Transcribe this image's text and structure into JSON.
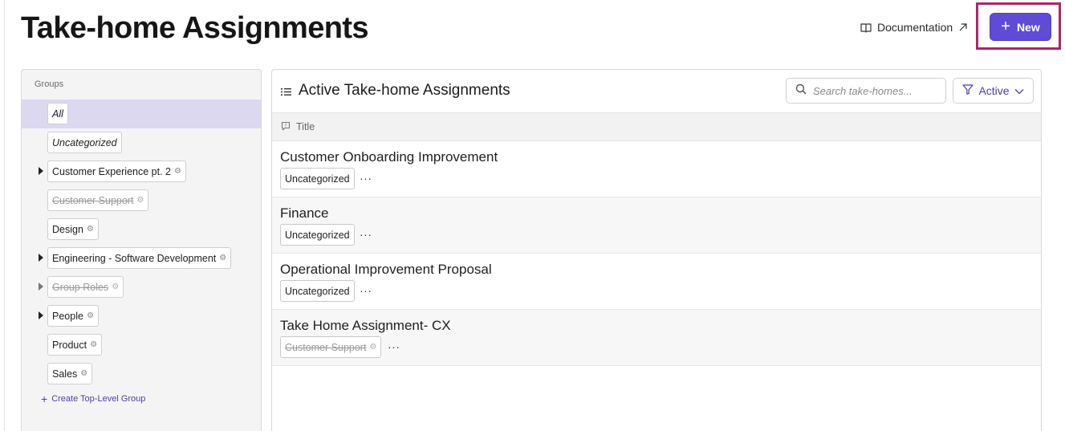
{
  "page": {
    "title": "Take-home Assignments"
  },
  "header": {
    "documentation_label": "Documentation",
    "new_button_label": "New"
  },
  "sidebar": {
    "heading": "Groups",
    "groups": [
      {
        "label": "All",
        "selected": true,
        "italic": true,
        "has_children": false,
        "struck": false,
        "people_icon": false
      },
      {
        "label": "Uncategorized",
        "selected": false,
        "italic": true,
        "has_children": false,
        "struck": false,
        "people_icon": false
      },
      {
        "label": "Customer Experience pt. 2",
        "selected": false,
        "italic": false,
        "has_children": true,
        "struck": false,
        "people_icon": true
      },
      {
        "label": "Customer Support",
        "selected": false,
        "italic": false,
        "has_children": false,
        "struck": true,
        "people_icon": true
      },
      {
        "label": "Design",
        "selected": false,
        "italic": false,
        "has_children": false,
        "struck": false,
        "people_icon": true
      },
      {
        "label": "Engineering - Software Development",
        "selected": false,
        "italic": false,
        "has_children": true,
        "struck": false,
        "people_icon": true
      },
      {
        "label": "Group Roles",
        "selected": false,
        "italic": false,
        "has_children": true,
        "struck": true,
        "people_icon": true
      },
      {
        "label": "People",
        "selected": false,
        "italic": false,
        "has_children": true,
        "struck": false,
        "people_icon": true
      },
      {
        "label": "Product",
        "selected": false,
        "italic": false,
        "has_children": false,
        "struck": false,
        "people_icon": true
      },
      {
        "label": "Sales",
        "selected": false,
        "italic": false,
        "has_children": false,
        "struck": false,
        "people_icon": true
      }
    ],
    "create_group_label": "Create Top-Level Group"
  },
  "main": {
    "title": "Active Take-home Assignments",
    "search_placeholder": "Search take-homes...",
    "filter_label": "Active",
    "column_title": "Title",
    "rows": [
      {
        "title": "Customer Onboarding Improvement",
        "tag": "Uncategorized",
        "tag_struck": false,
        "ellipsis": "···"
      },
      {
        "title": "Finance",
        "tag": "Uncategorized",
        "tag_struck": false,
        "ellipsis": "···"
      },
      {
        "title": "Operational Improvement Proposal",
        "tag": "Uncategorized",
        "tag_struck": false,
        "ellipsis": "···"
      },
      {
        "title": "Take Home Assignment- CX",
        "tag": "Customer Support",
        "tag_struck": true,
        "ellipsis": "···"
      }
    ]
  },
  "colors": {
    "accent": "#5f4bd6",
    "highlight_border": "#b0246a",
    "selected_group": "#dcd8ef"
  },
  "icons": [
    "book-icon",
    "external-arrow-icon",
    "plus-icon",
    "list-icon",
    "search-icon",
    "filter-icon",
    "chevron-down-icon",
    "comment-icon",
    "people-icon",
    "caret-right-icon"
  ]
}
